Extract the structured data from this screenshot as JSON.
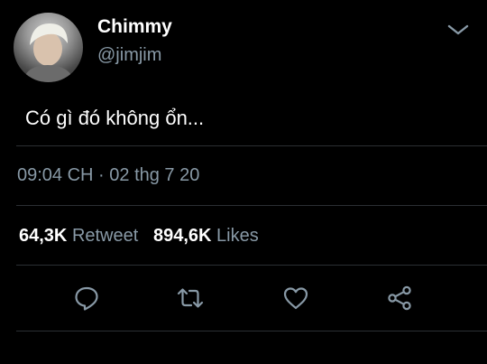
{
  "user": {
    "display_name": "Chimmy",
    "handle": "@jimjim"
  },
  "tweet": {
    "text": "Có gì đó không ổn...",
    "timestamp": "09:04 CH · 02 thg 7 20"
  },
  "stats": {
    "retweet_count": "64,3K",
    "retweet_label": "Retweet",
    "likes_count": "894,6K",
    "likes_label": "Likes"
  },
  "icons": {
    "menu": "chevron-down-icon",
    "reply": "reply-icon",
    "retweet": "retweet-icon",
    "like": "heart-icon",
    "share": "share-icon"
  },
  "colors": {
    "background": "#000000",
    "secondary_text": "#8899a6",
    "divider": "#2b2f33"
  }
}
